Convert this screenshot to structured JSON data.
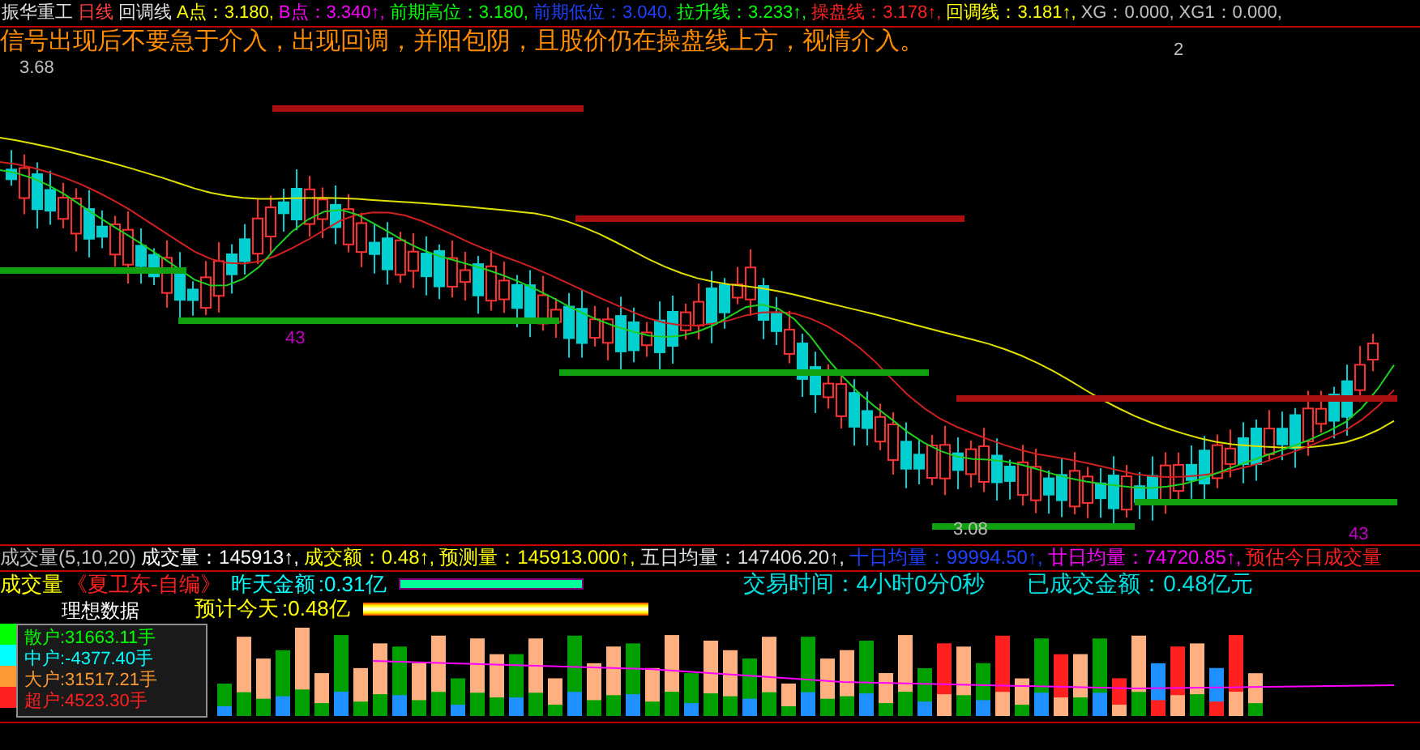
{
  "header": {
    "items": [
      {
        "text": "振华重工",
        "color": "#e0e0e0"
      },
      {
        "text": "日线",
        "color": "#ff4040"
      },
      {
        "text": "回调线",
        "color": "#e0e0e0"
      },
      {
        "text": "A点：3.180,",
        "color": "#ffff00"
      },
      {
        "text": "B点：3.340↑,",
        "color": "#ff00ff"
      },
      {
        "text": "前期高位：3.180,",
        "color": "#00ff00"
      },
      {
        "text": "前期低位：3.040,",
        "color": "#2040ff"
      },
      {
        "text": "拉升线：3.233↑,",
        "color": "#00ff00"
      },
      {
        "text": "操盘线：3.178↑,",
        "color": "#ff2020"
      },
      {
        "text": "回调线：3.181↑,",
        "color": "#ffff00"
      },
      {
        "text": "XG：0.000,",
        "color": "#c0c0c0"
      },
      {
        "text": "XG1：0.000,",
        "color": "#c0c0c0"
      }
    ]
  },
  "signal_text": "信号出现后不要急于介入，出现回调，并阳包阴，且股价仍在操盘线上方，视情介入。",
  "chart_labels": {
    "price_high": "3.68",
    "price_low": "3.08",
    "marks": [
      "43",
      "43"
    ],
    "signal_count": "2"
  },
  "volume": {
    "items": [
      {
        "text": "成交量(5,10,20)",
        "color": "#c0c0c0"
      },
      {
        "text": "成交量：145913↑,",
        "color": "#ffffff"
      },
      {
        "text": "成交额：0.48↑,",
        "color": "#ffff00"
      },
      {
        "text": "预测量：145913.000↑,",
        "color": "#ffff00"
      },
      {
        "text": "五日均量：147406.20↑,",
        "color": "#e0e0e0"
      },
      {
        "text": "十日均量：99994.50↑,",
        "color": "#2040ff"
      },
      {
        "text": "廿日均量：74720.85↑,",
        "color": "#ff00ff"
      },
      {
        "text": "预估今日成交量",
        "color": "#ff2020"
      }
    ]
  },
  "indicator": {
    "name": "成交量",
    "formula": "《夏卫东-自编》",
    "yesterday_label": "昨天金额",
    "yesterday_value": ":0.31亿",
    "today_label": "预计今天",
    "today_value": ":0.48亿"
  },
  "trade_info": {
    "time": "交易时间：4小时0分0秒",
    "amount": "已成交金额：0.48亿元"
  },
  "legend": {
    "title": "理想数据",
    "items": [
      {
        "label": "散户:31663.11手",
        "color": "#00ff00"
      },
      {
        "label": "中户:-4377.40手",
        "color": "#00ffff"
      },
      {
        "label": "大户:31517.21手",
        "color": "#ff9933"
      },
      {
        "label": "超户:4523.30手",
        "color": "#ff2020"
      }
    ]
  }
}
